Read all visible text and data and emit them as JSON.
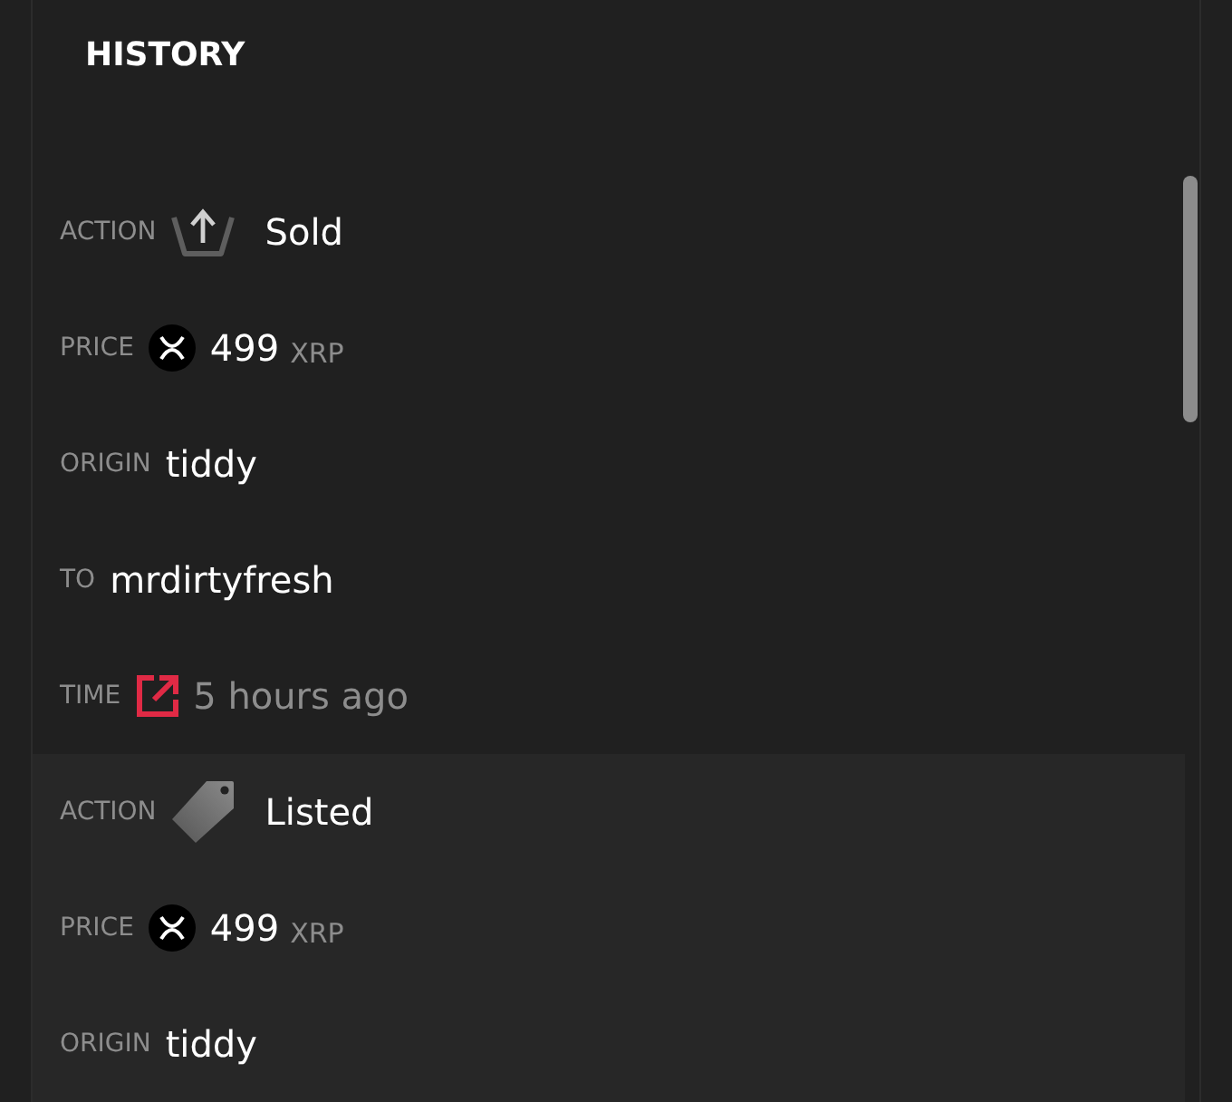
{
  "title": "HISTORY",
  "events": [
    {
      "kind": "sold",
      "rows": [
        {
          "kind": "action",
          "label": "ACTION",
          "value": "Sold"
        },
        {
          "kind": "price",
          "label": "PRICE",
          "value": "499",
          "unit": "XRP"
        },
        {
          "kind": "user",
          "label": "ORIGIN",
          "value": "tiddy"
        },
        {
          "kind": "user",
          "label": "TO",
          "value": "mrdirtyfresh"
        },
        {
          "kind": "time",
          "label": "TIME",
          "value": "5 hours ago"
        }
      ]
    },
    {
      "kind": "listed",
      "rows": [
        {
          "kind": "action",
          "label": "ACTION",
          "value": "Listed"
        },
        {
          "kind": "price",
          "label": "PRICE",
          "value": "499",
          "unit": "XRP"
        },
        {
          "kind": "user",
          "label": "ORIGIN",
          "value": "tiddy"
        }
      ]
    }
  ]
}
